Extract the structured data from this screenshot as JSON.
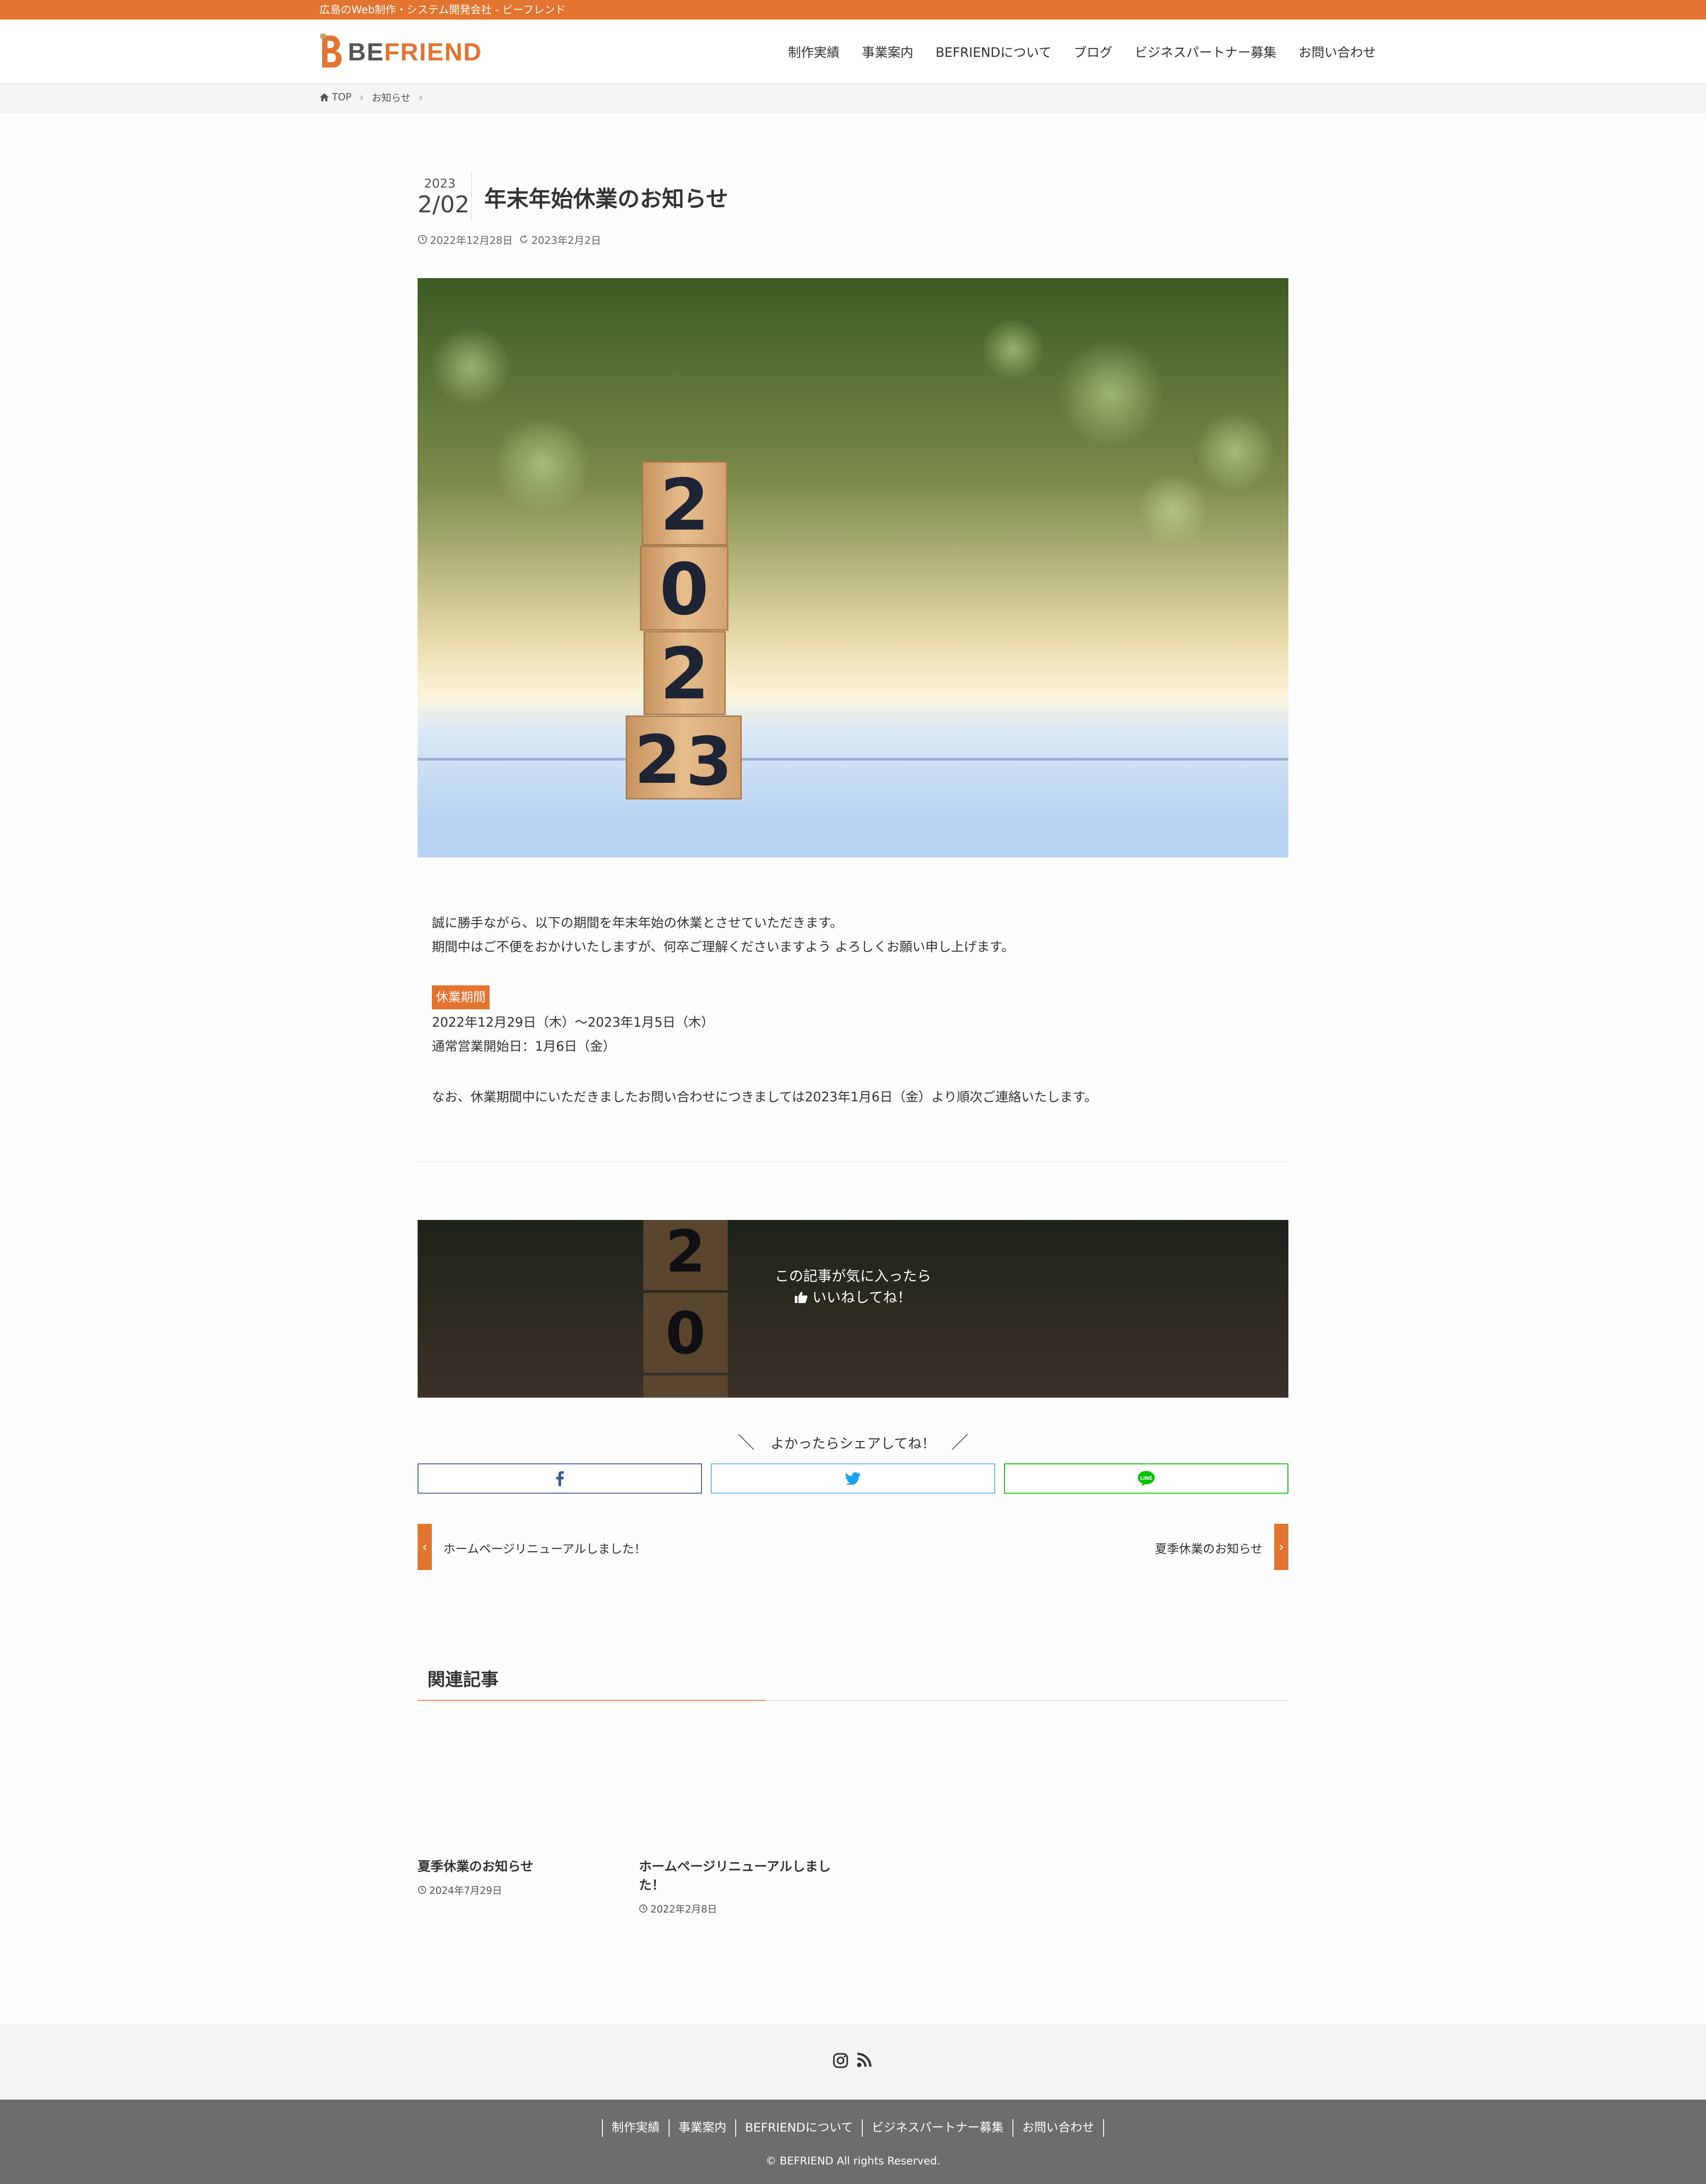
{
  "topbar": {
    "tagline": "広島のWeb制作・システム開発会社 - ビーフレンド"
  },
  "header": {
    "logo_be": "BE",
    "logo_friend": "FRIEND",
    "nav": [
      "制作実績",
      "事業案内",
      "BEFRIENDについて",
      "ブログ",
      "ビジネスパートナー募集",
      "お問い合わせ"
    ]
  },
  "breadcrumb": {
    "home": "TOP",
    "category": "お知らせ"
  },
  "article": {
    "date_year": "2023",
    "date_md": "2/02",
    "title": "年末年始休業のお知らせ",
    "published": "2022年12月28日",
    "updated": "2023年2月2日",
    "para1_line1": "誠に勝手ながら、以下の期間を年末年始の休業とさせていただきます。",
    "para1_line2": "期間中はご不便をおかけいたしますが、何卒ご理解くださいますよう よろしくお願い申し上げます。",
    "badge": "休業期間",
    "period": "2022年12月29日（木）〜2023年1月5日（木）",
    "reopen": "通常営業開始日：1月6日（金）",
    "note": "なお、休業期間中にいただきましたお問い合わせにつきましては2023年1月6日（金）より順次ご連絡いたします。"
  },
  "hero": {
    "block_digits": [
      "2",
      "0",
      "2",
      "2",
      "3"
    ]
  },
  "like_box": {
    "line1": "この記事が気に入ったら",
    "line2": "いいねしてね！",
    "digits": [
      "2",
      "0"
    ]
  },
  "share": {
    "heading": "よかったらシェアしてね！",
    "line_label": "LINE",
    "colors": {
      "facebook": "#3b5998",
      "twitter": "#1da1f2",
      "line": "#00c300"
    }
  },
  "post_nav": {
    "prev_title": "ホームページリニューアルしました！",
    "next_title": "夏季休業のお知らせ"
  },
  "related": {
    "heading": "関連記事",
    "items": [
      {
        "title": "夏季休業のお知らせ",
        "date": "2024年7月29日"
      },
      {
        "title_line1": "ホームページリニューアルしまし",
        "title_line2": "た！",
        "date": "2022年2月8日"
      }
    ]
  },
  "footer": {
    "nav": [
      "制作実績",
      "事業案内",
      "BEFRIENDについて",
      "ビジネスパートナー募集",
      "お問い合わせ"
    ],
    "copyright": "© BEFRIEND All rights Reserved."
  },
  "accent_color": "#e37430"
}
